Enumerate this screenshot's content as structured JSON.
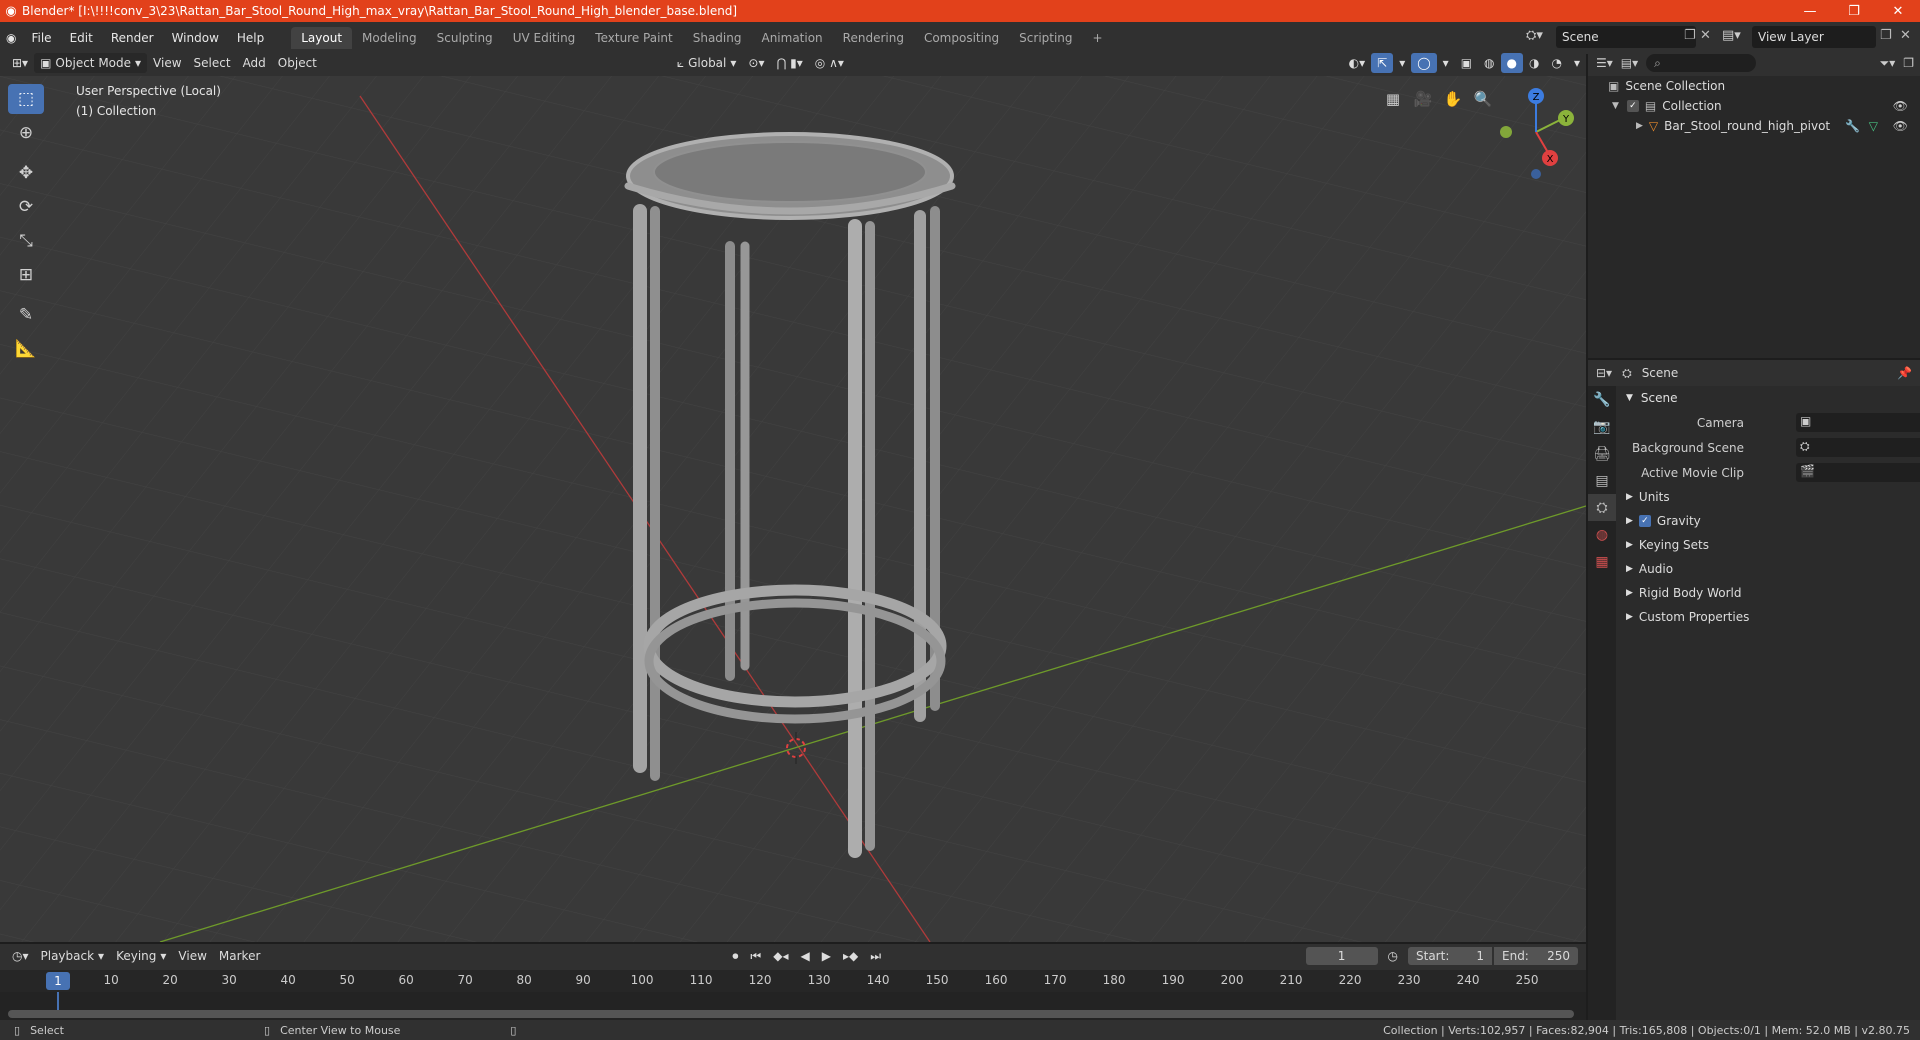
{
  "title_bar": {
    "text": "Blender* [I:\\!!!!conv_3\\23\\Rattan_Bar_Stool_Round_High_max_vray\\Rattan_Bar_Stool_Round_High_blender_base.blend]"
  },
  "menu": [
    "File",
    "Edit",
    "Render",
    "Window",
    "Help"
  ],
  "workspaces": [
    "Layout",
    "Modeling",
    "Sculpting",
    "UV Editing",
    "Texture Paint",
    "Shading",
    "Animation",
    "Rendering",
    "Compositing",
    "Scripting"
  ],
  "active_workspace": "Layout",
  "scene_field": "Scene",
  "view_layer_field": "View Layer",
  "viewport_header": {
    "mode": "Object Mode",
    "view": "View",
    "select": "Select",
    "add": "Add",
    "object": "Object",
    "orientation": "Global"
  },
  "viewport": {
    "perspective": "User Perspective (Local)",
    "collection": "(1) Collection"
  },
  "gizmo": {
    "x": "X",
    "y": "Y",
    "z": "Z"
  },
  "outliner": {
    "root": "Scene Collection",
    "collection": "Collection",
    "object": "Bar_Stool_round_high_pivot"
  },
  "properties": {
    "header": "Scene",
    "panel": "Scene",
    "camera_label": "Camera",
    "background_label": "Background Scene",
    "clip_label": "Active Movie Clip",
    "subpanels": [
      "Units",
      "Gravity",
      "Keying Sets",
      "Audio",
      "Rigid Body World",
      "Custom Properties"
    ]
  },
  "timeline": {
    "playback": "Playback",
    "keying": "Keying",
    "view": "View",
    "marker": "Marker",
    "current_frame": "1",
    "start_label": "Start:",
    "start": "1",
    "end_label": "End:",
    "end": "250",
    "ticks": [
      "1",
      "10",
      "20",
      "30",
      "40",
      "50",
      "60",
      "70",
      "80",
      "90",
      "100",
      "110",
      "120",
      "130",
      "140",
      "150",
      "160",
      "170",
      "180",
      "190",
      "200",
      "210",
      "220",
      "230",
      "240",
      "250"
    ]
  },
  "status": {
    "select": "Select",
    "center": "Center View to Mouse",
    "stats": "Collection | Verts:102,957 | Faces:82,904 | Tris:165,808 | Objects:0/1 | Mem: 52.0 MB | v2.80.75"
  }
}
